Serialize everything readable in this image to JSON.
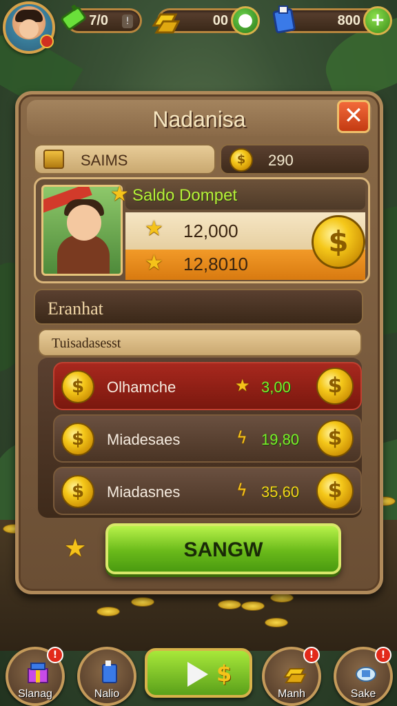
{
  "hud": {
    "energy_value": "7/0",
    "gold_value": "00",
    "gems_value": "800"
  },
  "panel": {
    "title": "Nadanisa",
    "close_glyph": "✕"
  },
  "summary": {
    "label": "SAIMS",
    "coin_value": "290"
  },
  "wallet": {
    "title": "Saldo Dompet",
    "amount_1": "12,000",
    "amount_2": "12,8010"
  },
  "section": {
    "heading": "Eranhat",
    "subheading": "Tuisadasesst"
  },
  "items": [
    {
      "name": "Olhamche",
      "price": "3,00"
    },
    {
      "name": "Miadesaes",
      "price": "19,80"
    },
    {
      "name": "Miadasnes",
      "price": "35,60"
    }
  ],
  "buy_button": {
    "label": "SANGW"
  },
  "nav": {
    "items": [
      {
        "label": "Slanag",
        "badge": "!"
      },
      {
        "label": "Nalio",
        "badge": ""
      },
      {
        "label": "Manh",
        "badge": "!"
      },
      {
        "label": "Sake",
        "badge": "!"
      }
    ],
    "play_symbol": "$"
  },
  "colors": {
    "accent_green": "#7af02a",
    "highlight_red": "#a8281e",
    "coin_gold": "#f5c81a",
    "panel_brown": "#8a6a48"
  },
  "icons": {
    "energy": "battery-icon",
    "gold": "gold-bar-icon",
    "gems": "gem-box-icon",
    "add": "plus-icon",
    "close": "close-icon",
    "coin": "dollar-coin-icon",
    "star": "star-icon",
    "play": "play-icon"
  }
}
